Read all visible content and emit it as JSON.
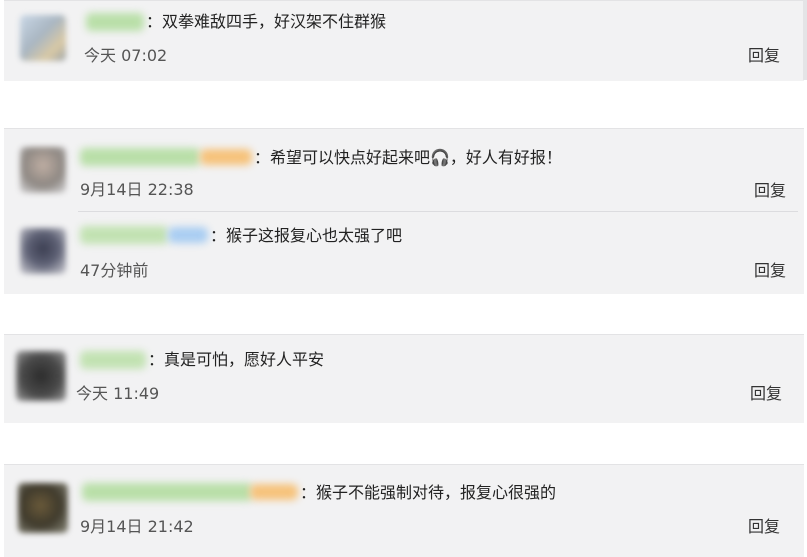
{
  "comments": [
    {
      "text": "：双拳难敌四手，好汉架不住群猴",
      "time": "今天 07:02",
      "reply": "回复"
    },
    {
      "text": "：希望可以快点好起来吧🎧，好人有好报！",
      "time": "9月14日 22:38",
      "reply": "回复"
    },
    {
      "text": "：猴子这报复心也太强了吧",
      "time": "47分钟前",
      "reply": "回复"
    },
    {
      "text": "：真是可怕，愿好人平安",
      "time": "今天 11:49",
      "reply": "回复"
    },
    {
      "text": "：猴子不能强制对待，报复心很强的",
      "time": "9月14日 21:42",
      "reply": "回复"
    }
  ],
  "colors": {
    "card_bg": "#f2f2f3",
    "username_blur": "#b9dfa8",
    "badge_orange": "#f6c27a",
    "badge_blue": "#a9cdf2"
  }
}
